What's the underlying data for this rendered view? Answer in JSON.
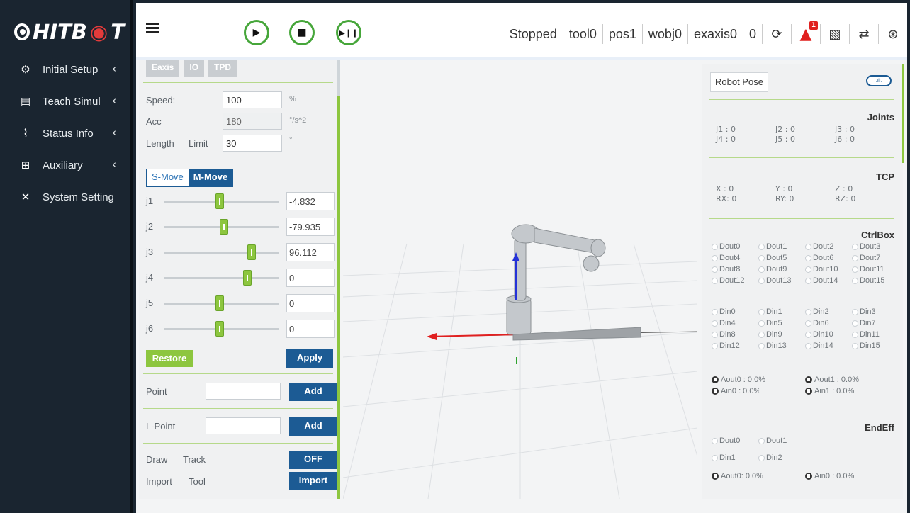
{
  "brand": {
    "prefix": "HITB",
    "accent": "",
    "suffix": "T",
    "accent_color": "#e23b3b"
  },
  "sidebar": {
    "items": [
      {
        "label": "Initial Setup",
        "icon": "gear-icon",
        "has_chevron": true
      },
      {
        "label": "Teach Simul",
        "icon": "list-icon",
        "has_chevron": true
      },
      {
        "label": "Status Info",
        "icon": "pulse-icon",
        "has_chevron": true
      },
      {
        "label": "Auxiliary",
        "icon": "grid-icon",
        "has_chevron": true
      },
      {
        "label": "System Setting",
        "icon": "tools-icon",
        "has_chevron": false
      }
    ]
  },
  "topbar": {
    "controls": [
      {
        "name": "play-button",
        "icon": "play-icon"
      },
      {
        "name": "stop-button",
        "icon": "stop-icon"
      },
      {
        "name": "step-button",
        "icon": "play-pause-icon"
      }
    ],
    "status": "Stopped",
    "tool": "tool0",
    "pos": "pos1",
    "wobj": "wobj0",
    "exaxis": "exaxis0",
    "count": "0",
    "alarm_count": "1"
  },
  "left": {
    "tabs": [
      "Eaxis",
      "IO",
      "TPD"
    ],
    "speed_label": "Speed:",
    "speed_value": "100",
    "speed_unit": "%",
    "acc_label": "Acc",
    "acc_value": "180",
    "acc_unit": "°/s^2",
    "length_label": "Length",
    "limit_label": "Limit",
    "length_value": "30",
    "length_unit": "°",
    "mode_s": "S-Move",
    "mode_m": "M-Move",
    "joints": [
      {
        "label": "j1",
        "value": "-4.832",
        "level": 0.48
      },
      {
        "label": "j2",
        "value": "-79.935",
        "level": 0.52
      },
      {
        "label": "j3",
        "value": "96.112",
        "level": 0.78
      },
      {
        "label": "j4",
        "value": "0",
        "level": 0.74
      },
      {
        "label": "j5",
        "value": "0",
        "level": 0.48
      },
      {
        "label": "j6",
        "value": "0",
        "level": 0.48
      }
    ],
    "restore_label": "Restore",
    "apply_label": "Apply",
    "point_label": "Point",
    "point_add": "Add",
    "lpoint_label": "L-Point",
    "lpoint_add": "Add",
    "draw_label": "Draw",
    "track_label": "Track",
    "track_toggle": "OFF",
    "import_label": "Import",
    "tool_label": "Tool",
    "import_button": "Import"
  },
  "right": {
    "pose_button": "Robot Pose",
    "joints_title": "Joints",
    "joints": [
      "J1 : 0",
      "J2 : 0",
      "J3 : 0",
      "J4 : 0",
      "J5 : 0",
      "J6 : 0"
    ],
    "tcp_title": "TCP",
    "tcp": [
      "X  : 0",
      "Y  : 0",
      "Z  : 0",
      "RX: 0",
      "RY: 0",
      "RZ: 0"
    ],
    "ctrlbox_title": "CtrlBox",
    "douts": [
      "Dout0",
      "Dout1",
      "Dout2",
      "Dout3",
      "Dout4",
      "Dout5",
      "Dout6",
      "Dout7",
      "Dout8",
      "Dout9",
      "Dout10",
      "Dout11",
      "Dout12",
      "Dout13",
      "Dout14",
      "Dout15"
    ],
    "dins": [
      "Din0",
      "Din1",
      "Din2",
      "Din3",
      "Din4",
      "Din5",
      "Din6",
      "Din7",
      "Din8",
      "Din9",
      "Din10",
      "Din11",
      "Din12",
      "Din13",
      "Din14",
      "Din15"
    ],
    "analog": [
      "Aout0 : 0.0%",
      "Aout1 : 0.0%",
      "Ain0  : 0.0%",
      "Ain1  : 0.0%"
    ],
    "endeff_title": "EndEff",
    "endeff_douts": [
      "Dout0",
      "Dout1"
    ],
    "endeff_dins": [
      "Din1",
      "Din2"
    ],
    "endeff_analog": [
      "Aout0: 0.0%",
      "Ain0  : 0.0%"
    ]
  }
}
